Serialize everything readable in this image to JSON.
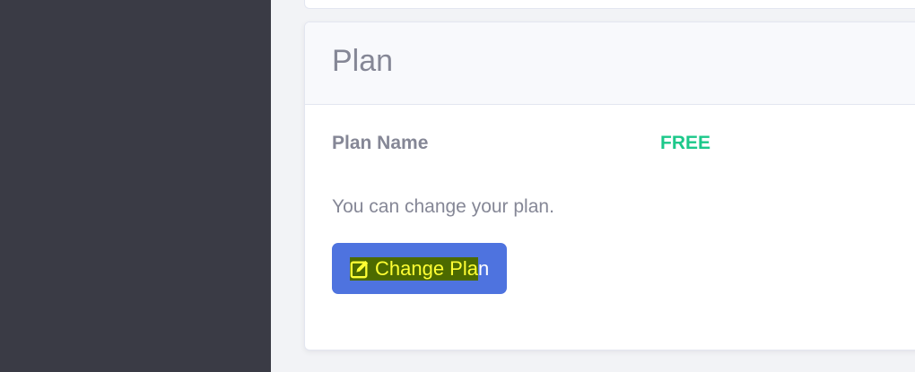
{
  "card": {
    "title": "Plan",
    "plan_name_label": "Plan Name",
    "plan_name_value": "FREE",
    "description": "You can change your plan.",
    "button": {
      "selected_text": "Change Pla",
      "rest_text": "n"
    }
  }
}
